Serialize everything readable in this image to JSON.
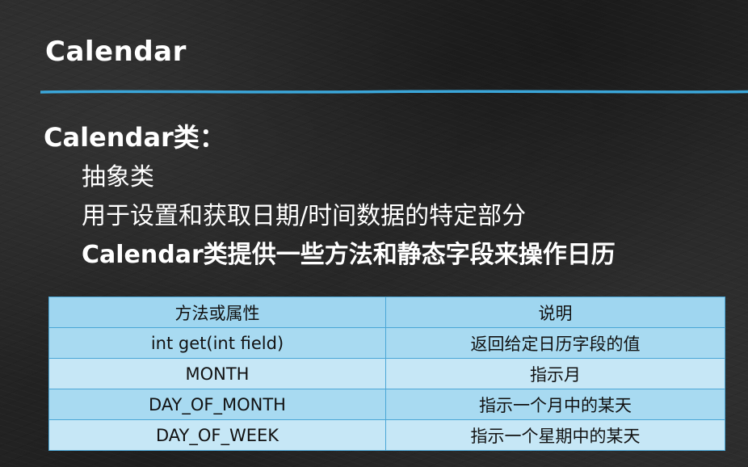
{
  "slide": {
    "title": "Calendar",
    "heading": "Calendar类：",
    "bullets": [
      {
        "text": "抽象类",
        "bold": false
      },
      {
        "text": "用于设置和获取日期/时间数据的特定部分",
        "bold": false
      },
      {
        "text": "Calendar类提供一些方法和静态字段来操作日历",
        "bold": true
      }
    ],
    "accent_color": "#3ba6d9"
  },
  "table": {
    "headers": [
      "方法或属性",
      "说明"
    ],
    "rows": [
      [
        "int get(int field)",
        "返回给定日历字段的值"
      ],
      [
        "MONTH",
        "指示月"
      ],
      [
        "DAY_OF_MONTH",
        "指示一个月中的某天"
      ],
      [
        "DAY_OF_WEEK",
        "指示一个星期中的某天"
      ]
    ]
  }
}
